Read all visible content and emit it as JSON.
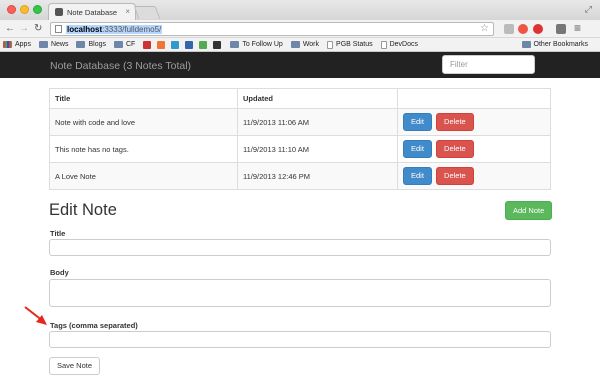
{
  "browser": {
    "tab_title": "Note Database",
    "tab_close": "×",
    "url_host": "localhost",
    "url_path": ":3333/fulldemo5/",
    "back_glyph": "←",
    "forward_glyph": "→",
    "reload_glyph": "↻",
    "home_glyph": "⌂",
    "star_glyph": "☆",
    "menu_glyph": "≡",
    "expand_glyph": "⤢",
    "bookmarks": [
      {
        "label": "Apps",
        "icon": "apps-icon"
      },
      {
        "label": "News",
        "icon": "folder-icon"
      },
      {
        "label": "Blogs",
        "icon": "folder-icon"
      },
      {
        "label": "CF",
        "icon": "folder-icon"
      },
      {
        "label": "To Follow Up",
        "icon": "folder-icon"
      },
      {
        "label": "Work",
        "icon": "folder-icon"
      },
      {
        "label": "PGB Status",
        "icon": "page-icon"
      },
      {
        "label": "DevDocs",
        "icon": "page-icon"
      }
    ],
    "other_bookmarks": "Other Bookmarks"
  },
  "app": {
    "brand": "Note Database (3 Notes Total)",
    "filter_placeholder": "Filter"
  },
  "table": {
    "headers": [
      "Title",
      "Updated",
      ""
    ],
    "rows": [
      {
        "title": "Note with code and love",
        "updated": "11/9/2013 11:06 AM",
        "edit": "Edit",
        "delete": "Delete"
      },
      {
        "title": "This note has no tags.",
        "updated": "11/9/2013 11:10 AM",
        "edit": "Edit",
        "delete": "Delete"
      },
      {
        "title": "A Love Note",
        "updated": "11/9/2013 12:46 PM",
        "edit": "Edit",
        "delete": "Delete"
      }
    ]
  },
  "form": {
    "heading": "Edit Note",
    "add_button": "Add Note",
    "title_label": "Title",
    "title_value": "",
    "body_label": "Body",
    "body_value": "",
    "tags_label": "Tags (comma separated)",
    "tags_value": "",
    "save_button": "Save Note"
  },
  "colors": {
    "navbar": "#222222",
    "primary": "#428bca",
    "danger": "#d9534f",
    "success": "#5cb85c",
    "annotation_arrow": "#e8261c"
  }
}
